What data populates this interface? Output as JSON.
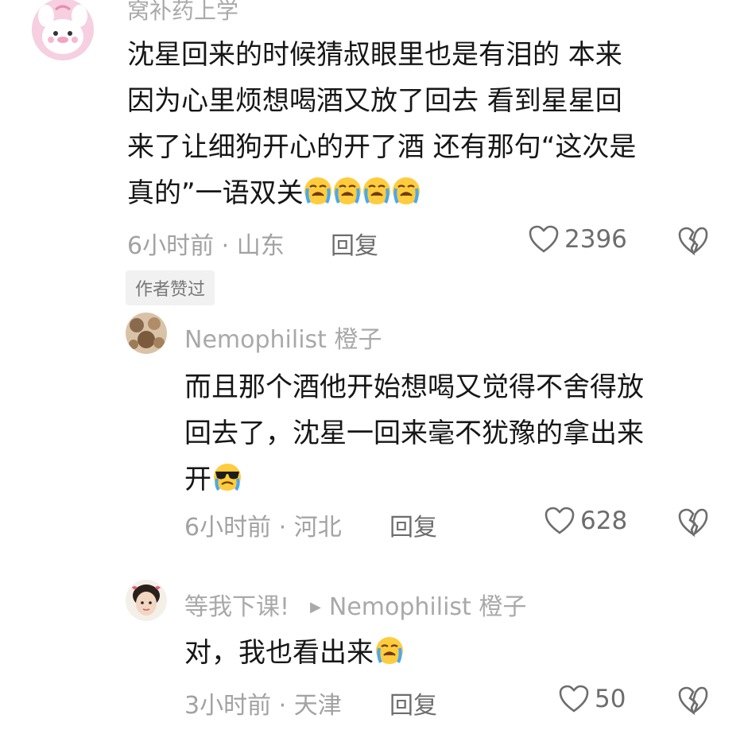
{
  "comments": [
    {
      "username": "窝补药上学",
      "lines": [
        "沈星回来的时候猜叔眼里也是有泪的 本来",
        "因为心里烦想喝酒又放了回去 看到星星回",
        "来了让细狗开心的开了酒 还有那句“这次是",
        "真的”一语双关"
      ],
      "emojis": [
        "loudly-crying-face",
        "loudly-crying-face",
        "loudly-crying-face",
        "loudly-crying-face"
      ],
      "meta": "6小时前 · 山东",
      "reply_label": "回复",
      "likes": "2396",
      "badge": "作者赞过"
    },
    {
      "username": "Nemophilist 橙子",
      "lines": [
        "而且那个酒他开始想喝又觉得不舍得放",
        "回去了，沈星一回来毫不犹豫的拿出来",
        "开"
      ],
      "emojis": [
        "sunglasses-crying-face"
      ],
      "meta": "6小时前 · 河北",
      "reply_label": "回复",
      "likes": "628"
    },
    {
      "username": "等我下课!",
      "reply_to": "Nemophilist 橙子",
      "lines": [
        "对，我也看出来"
      ],
      "emojis": [
        "loudly-crying-face"
      ],
      "meta": "3小时前 · 天津",
      "reply_label": "回复",
      "likes": "50"
    }
  ],
  "colors": {
    "text": "#161616",
    "meta": "#a2a2a2",
    "username": "#a9a9a9",
    "badge_bg": "#f1f1f1"
  }
}
